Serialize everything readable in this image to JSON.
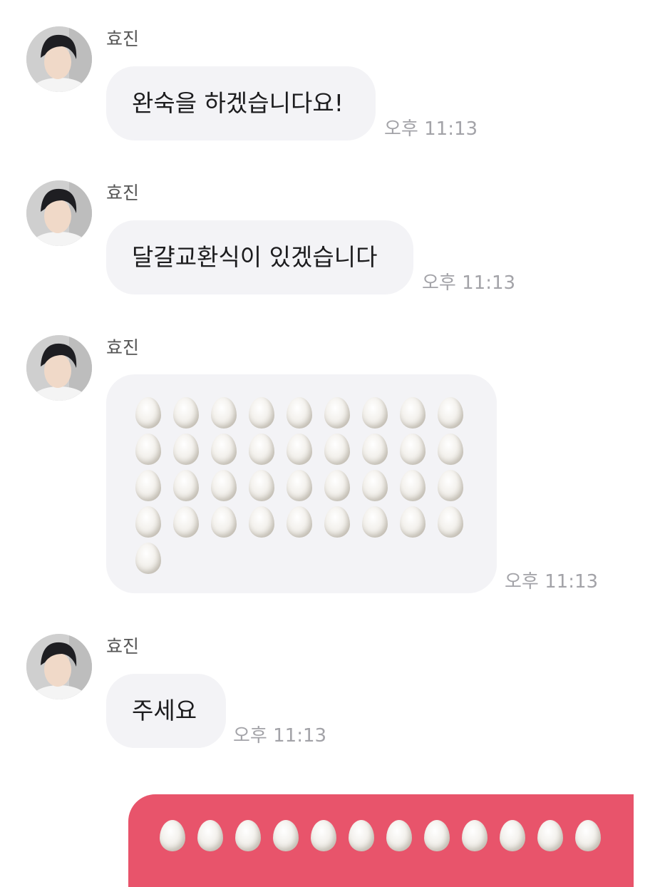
{
  "messages": [
    {
      "sender": "효진",
      "text": "완숙을 하겠습니다요!",
      "time": "오후 11:13"
    },
    {
      "sender": "효진",
      "text": "달걀교환식이 있겠습니다",
      "time": "오후 11:13"
    },
    {
      "sender": "효진",
      "emoji": "🥚",
      "emoji_count": 37,
      "time": "오후 11:13"
    },
    {
      "sender": "효진",
      "text": "주세요",
      "time": "오후 11:13"
    }
  ],
  "sent_message": {
    "emoji": "🥚",
    "visible_emoji_count": 12
  },
  "colors": {
    "received_bubble": "#f3f3f6",
    "sent_bubble": "#e8546b",
    "time_text": "#a3a3a8",
    "sender_text": "#555555"
  }
}
